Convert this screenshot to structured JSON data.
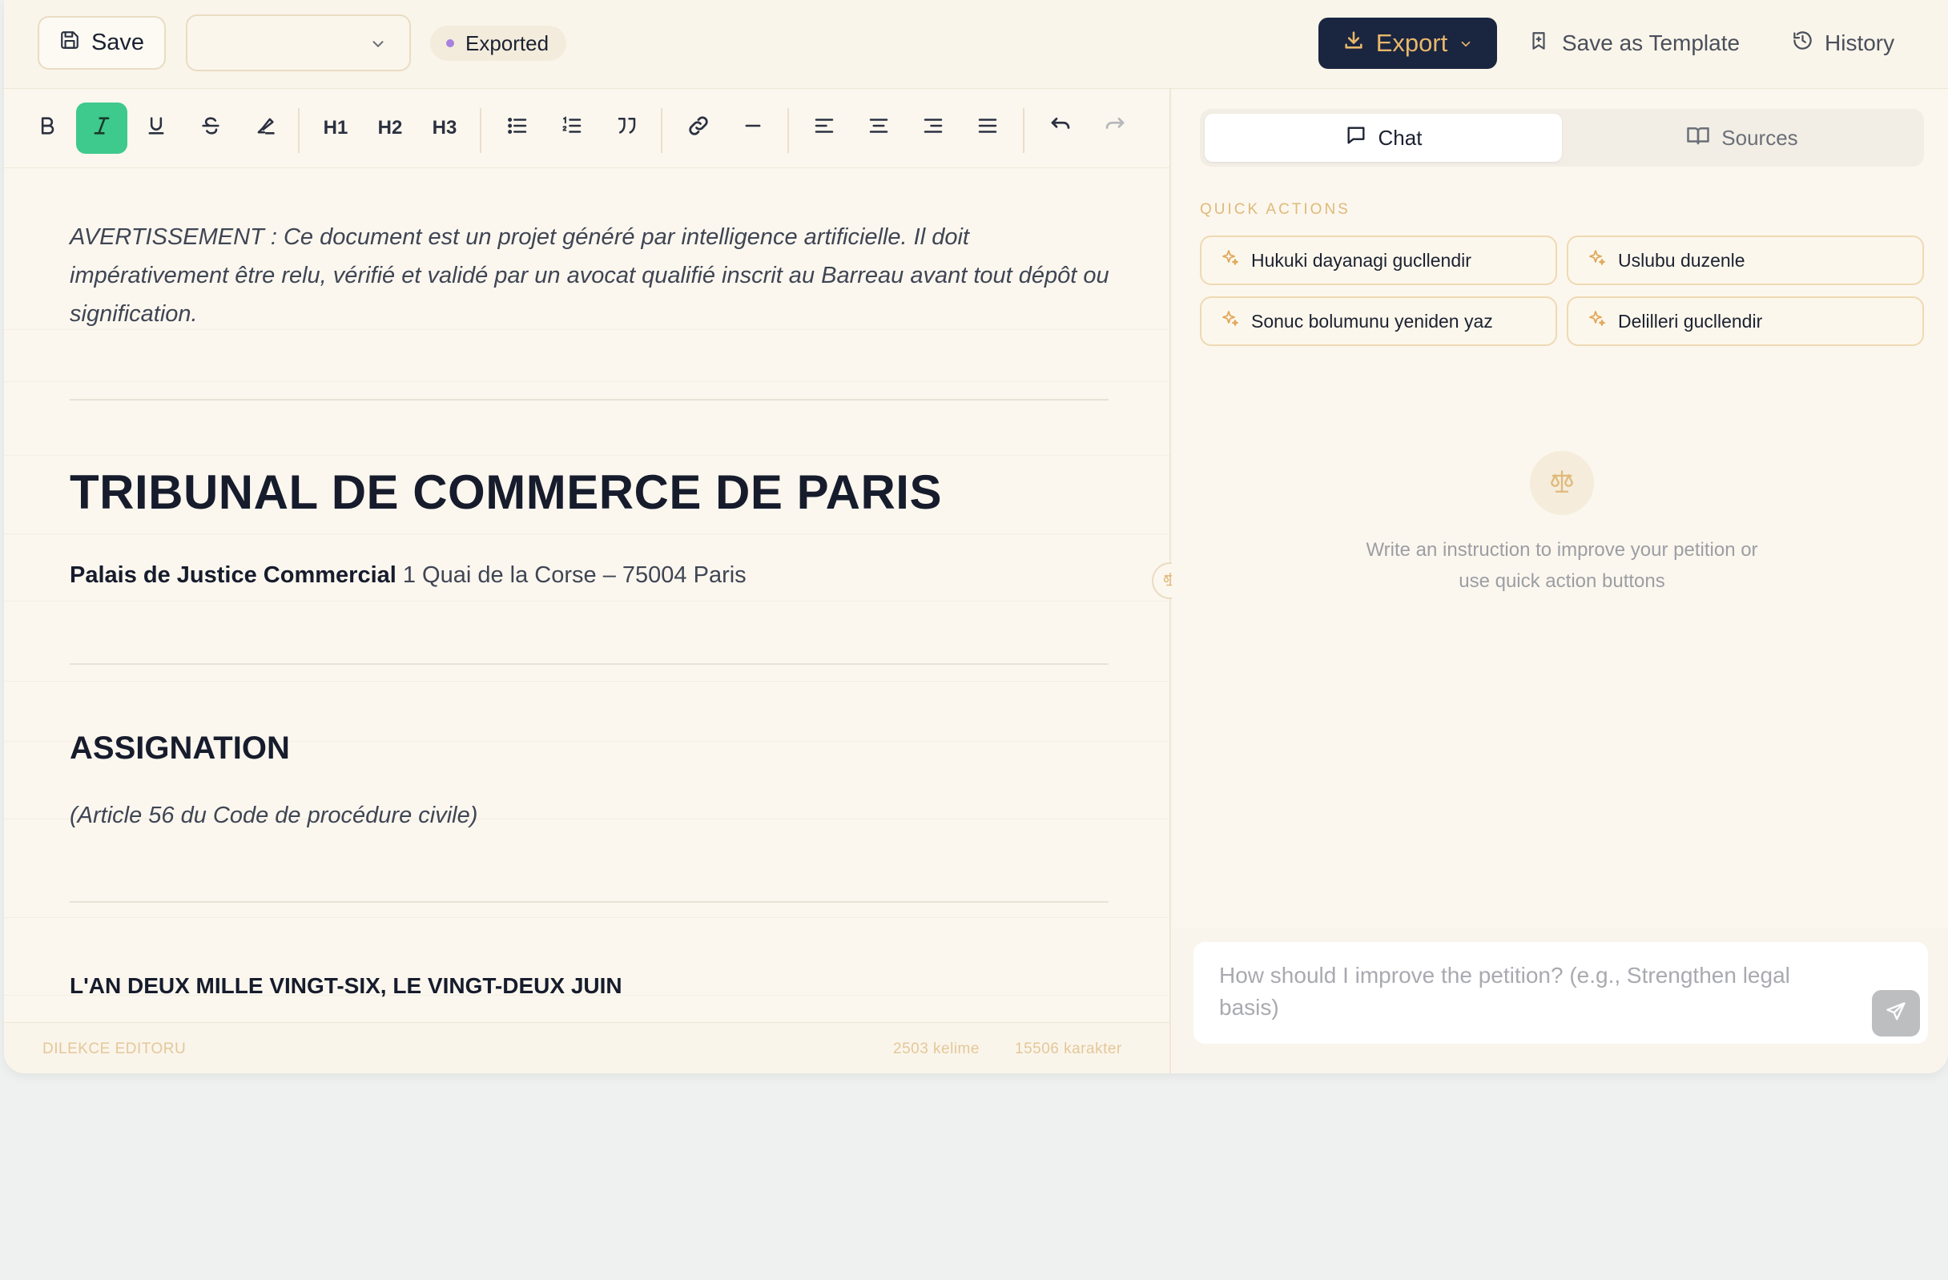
{
  "topbar": {
    "save_label": "Save",
    "select_value": "",
    "status_badge": "Exported",
    "export_label": "Export",
    "save_template_label": "Save as Template",
    "history_label": "History"
  },
  "toolbar": {
    "h1": "H1",
    "h2": "H2",
    "h3": "H3"
  },
  "document": {
    "warning": "AVERTISSEMENT : Ce document est un projet généré par intelligence artificielle. Il doit impérativement être relu, vérifié et validé par un avocat qualifié inscrit au Barreau avant tout dépôt ou signification.",
    "court_title": "TRIBUNAL DE COMMERCE DE PARIS",
    "court_name": "Palais de Justice Commercial",
    "court_address": " 1 Quai de la Corse – 75004 Paris",
    "section_title": "ASSIGNATION",
    "article_ref": "(Article 56 du Code de procédure civile)",
    "date_line": "L'AN DEUX MILLE VINGT-SIX, LE VINGT-DEUX JUIN"
  },
  "footer": {
    "editor_name": "DILEKCE EDITORU",
    "word_count": "2503 kelime",
    "char_count": "15506 karakter"
  },
  "panel": {
    "tabs": [
      {
        "label": "Chat"
      },
      {
        "label": "Sources"
      }
    ],
    "quick_actions_title": "QUICK ACTIONS",
    "quick_actions": [
      {
        "label": "Hukuki dayanagi gucllendir"
      },
      {
        "label": "Uslubu duzenle"
      },
      {
        "label": "Sonuc bolumunu yeniden yaz"
      },
      {
        "label": "Delilleri gucllendir"
      }
    ],
    "empty_state": "Write an instruction to improve your petition or use quick action buttons",
    "input_placeholder": "How should I improve the petition? (e.g., Strengthen legal basis)"
  },
  "colors": {
    "accent_green": "#3ec98d",
    "export_bg": "#1a2540",
    "export_text": "#e8b86a",
    "gold": "#e0b97a",
    "badge_dot": "#a880e0"
  },
  "icons": {
    "save": "floppy-disk-icon",
    "export": "download-icon",
    "template": "bookmark-icon",
    "history": "clock-history-icon",
    "chat": "chat-bubble-icon",
    "sources": "open-book-icon",
    "quick_action": "sparkle-icon",
    "empty_state": "scales-icon",
    "send": "paper-plane-icon"
  }
}
